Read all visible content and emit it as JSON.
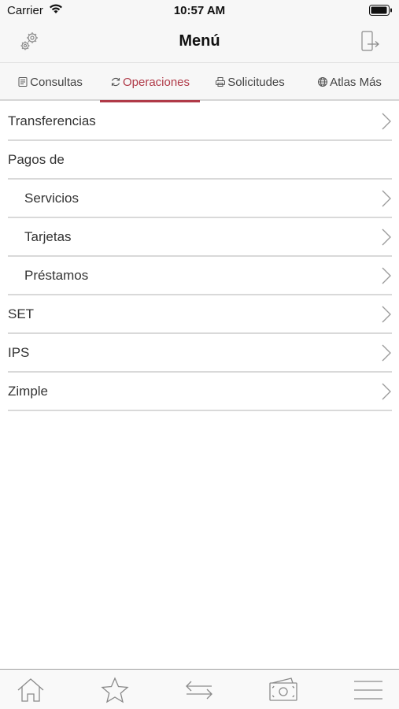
{
  "status_bar": {
    "carrier": "Carrier",
    "time": "10:57 AM"
  },
  "nav": {
    "title": "Menú",
    "left_icon": "settings-gears-icon",
    "right_icon": "logout-icon"
  },
  "tabs": [
    {
      "label": "Consultas",
      "icon": "document-icon",
      "active": false
    },
    {
      "label": "Operaciones",
      "icon": "refresh-icon",
      "active": true
    },
    {
      "label": "Solicitudes",
      "icon": "printer-icon",
      "active": false
    },
    {
      "label": "Atlas Más",
      "icon": "globe-icon",
      "active": false
    }
  ],
  "menu": {
    "transferencias": "Transferencias",
    "pagos_de": "Pagos de",
    "servicios": "Servicios",
    "tarjetas": "Tarjetas",
    "prestamos": "Préstamos",
    "set": "SET",
    "ips": "IPS",
    "zimple": "Zimple"
  },
  "bottom_bar": [
    "home-icon",
    "star-icon",
    "transfer-arrows-icon",
    "money-icon",
    "hamburger-menu-icon"
  ],
  "colors": {
    "accent": "#b03a48",
    "separator": "#d9d9d9",
    "icon_gray": "#8a8a8a"
  }
}
